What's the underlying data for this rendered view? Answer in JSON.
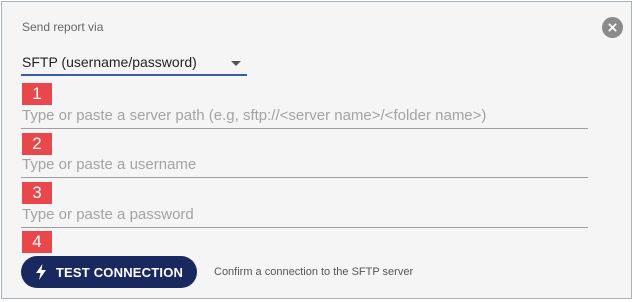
{
  "dialog": {
    "title": "Send report via",
    "close_icon": "close-icon"
  },
  "method_select": {
    "value": "SFTP (username/password)"
  },
  "steps": [
    "1",
    "2",
    "3",
    "4"
  ],
  "fields": {
    "server_path": {
      "placeholder": "Type or paste a server path (e.g, sftp://<server name>/<folder name>)",
      "value": ""
    },
    "username": {
      "placeholder": "Type or paste a username",
      "value": ""
    },
    "password": {
      "placeholder": "Type or paste a password",
      "value": ""
    }
  },
  "test_connection": {
    "label": "TEST CONNECTION",
    "icon": "lightning-bolt-icon",
    "hint": "Confirm a connection to the SFTP server"
  },
  "colors": {
    "badge": "#e8474b",
    "button": "#1a2860",
    "select_underline": "#3a5da8"
  }
}
